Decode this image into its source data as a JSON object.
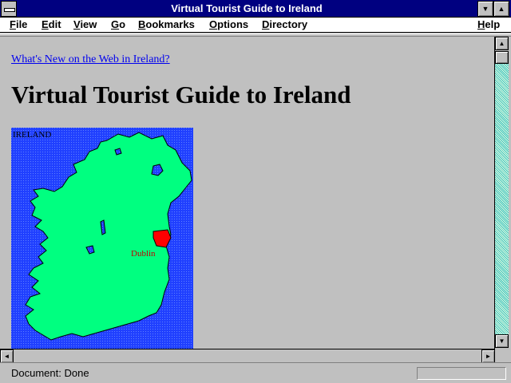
{
  "window": {
    "title": "Virtual Tourist Guide to Ireland",
    "buttons": {
      "minimize": "▼",
      "maximize": "▲"
    }
  },
  "menu": [
    {
      "id": "file",
      "label": "File"
    },
    {
      "id": "edit",
      "label": "Edit"
    },
    {
      "id": "view",
      "label": "View"
    },
    {
      "id": "go",
      "label": "Go"
    },
    {
      "id": "bookmarks",
      "label": "Bookmarks"
    },
    {
      "id": "options",
      "label": "Options"
    },
    {
      "id": "directory",
      "label": "Directory"
    },
    {
      "id": "help",
      "label": "Help"
    }
  ],
  "page": {
    "whats_new_link": "What's New on the Web in Ireland?",
    "heading": "Virtual Tourist Guide to Ireland",
    "map": {
      "label": "IRELAND",
      "city_label": "Dublin",
      "colors": {
        "sea": "#2040ff",
        "land": "#00ff80",
        "city": "#ff0000",
        "city_text": "#c00000"
      }
    }
  },
  "scrollbar": {
    "up_arrow": "▲",
    "down_arrow": "▼",
    "left_arrow": "◄",
    "right_arrow": "►"
  },
  "status": {
    "text": "Document: Done"
  }
}
